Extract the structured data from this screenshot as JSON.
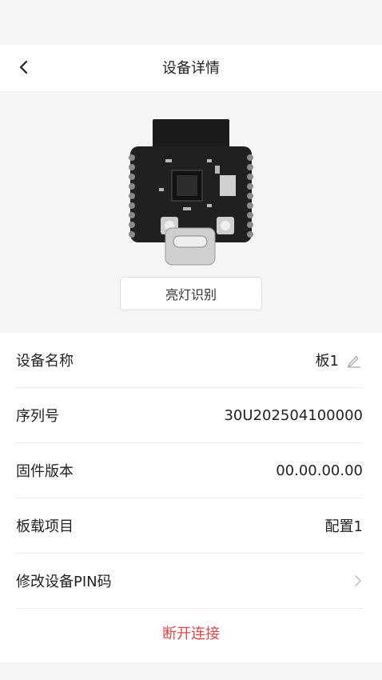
{
  "header": {
    "title": "设备详情",
    "back_icon": "chevron-left-icon"
  },
  "hero": {
    "identify_button": "亮灯识别"
  },
  "details": [
    {
      "label": "设备名称",
      "value": "板1",
      "action_icon": "pencil-icon"
    },
    {
      "label": "序列号",
      "value": "30U202504100000"
    },
    {
      "label": "固件版本",
      "value": "00.00.00.00"
    },
    {
      "label": "板载项目",
      "value": "配置1"
    },
    {
      "label": "修改设备PIN码",
      "action_icon": "chevron-right-icon"
    }
  ],
  "disconnect_label": "断开连接",
  "colors": {
    "danger": "#e04848",
    "background": "#f5f5f5",
    "surface": "#ffffff"
  }
}
